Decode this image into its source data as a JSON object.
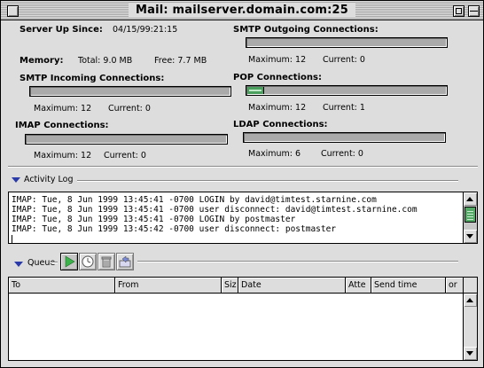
{
  "window": {
    "title": "Mail: mailserver.domain.com:25"
  },
  "status": {
    "server_up_label": "Server Up Since:",
    "server_up_value": "04/15/99:21:15",
    "memory_label": "Memory:",
    "memory_total": "Total: 9.0 MB",
    "memory_free": "Free: 7.7 MB",
    "connections": [
      {
        "name": "SMTP Outgoing Connections:",
        "maximum": "Maximum: 12",
        "current": "Current: 0",
        "level": 0
      },
      {
        "name": "SMTP Incoming Connections:",
        "maximum": "Maximum: 12",
        "current": "Current: 0",
        "level": 0
      },
      {
        "name": "POP Connections:",
        "maximum": "Maximum: 12",
        "current": "Current: 1",
        "level": 0.0833
      },
      {
        "name": "IMAP Connections:",
        "maximum": "Maximum: 12",
        "current": "Current: 0",
        "level": 0
      },
      {
        "name": "LDAP Connections:",
        "maximum": "Maximum: 6",
        "current": "Current: 0",
        "level": 0
      }
    ]
  },
  "activity_log": {
    "label": "Activity Log",
    "lines": [
      "IMAP: Tue, 8 Jun 1999 13:45:41 -0700 LOGIN by david@timtest.starnine.com",
      "IMAP: Tue, 8 Jun 1999 13:45:41 -0700 user disconnect: david@timtest.starnine.com",
      "IMAP: Tue, 8 Jun 1999 13:45:41 -0700 LOGIN by postmaster",
      "IMAP: Tue, 8 Jun 1999 13:45:42 -0700 user disconnect: postmaster"
    ]
  },
  "queue": {
    "label": "Queue",
    "columns": [
      "To",
      "From",
      "Siz",
      "Date",
      "Atte",
      "Send time",
      "or"
    ]
  },
  "colors": {
    "progress_fill": "#4a9e5e",
    "disclosure": "#2a3aa8",
    "play_icon": "#3cb34a"
  },
  "icons": [
    "close-box-icon",
    "zoom-box-icon",
    "collapse-box-icon",
    "play-icon",
    "clock-icon",
    "trash-icon",
    "return-icon"
  ]
}
